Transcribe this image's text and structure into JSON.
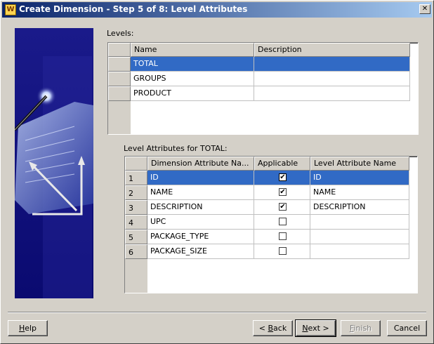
{
  "window": {
    "title": "Create Dimension - Step 5 of 8: Level Attributes",
    "icon": "wizard-icon",
    "close_glyph": "✕"
  },
  "levels": {
    "label": "Levels:",
    "columns": [
      "Name",
      "Description"
    ],
    "rows": [
      {
        "name": "TOTAL",
        "description": "",
        "selected": true
      },
      {
        "name": "GROUPS",
        "description": "",
        "selected": false
      },
      {
        "name": "PRODUCT",
        "description": "",
        "selected": false
      }
    ]
  },
  "attributes": {
    "label": "Level Attributes for TOTAL:",
    "columns": [
      "Dimension Attribute Na...",
      "Applicable",
      "Level Attribute Name"
    ],
    "rows": [
      {
        "num": "1",
        "name": "ID",
        "applicable": true,
        "level_name": "ID",
        "selected": true
      },
      {
        "num": "2",
        "name": "NAME",
        "applicable": true,
        "level_name": "NAME",
        "selected": false
      },
      {
        "num": "3",
        "name": "DESCRIPTION",
        "applicable": true,
        "level_name": "DESCRIPTION",
        "selected": false
      },
      {
        "num": "4",
        "name": "UPC",
        "applicable": false,
        "level_name": "",
        "selected": false
      },
      {
        "num": "5",
        "name": "PACKAGE_TYPE",
        "applicable": false,
        "level_name": "",
        "selected": false
      },
      {
        "num": "6",
        "name": "PACKAGE_SIZE",
        "applicable": false,
        "level_name": "",
        "selected": false
      }
    ]
  },
  "buttons": {
    "help": {
      "pre": "",
      "ul": "H",
      "post": "elp"
    },
    "back": {
      "pre": "< ",
      "ul": "B",
      "post": "ack"
    },
    "next": {
      "pre": "",
      "ul": "N",
      "post": "ext >"
    },
    "finish": {
      "pre": "",
      "ul": "F",
      "post": "inish",
      "disabled": true
    },
    "cancel": {
      "pre": "",
      "ul": "",
      "post": "Cancel"
    }
  },
  "check_glyph": "✔"
}
